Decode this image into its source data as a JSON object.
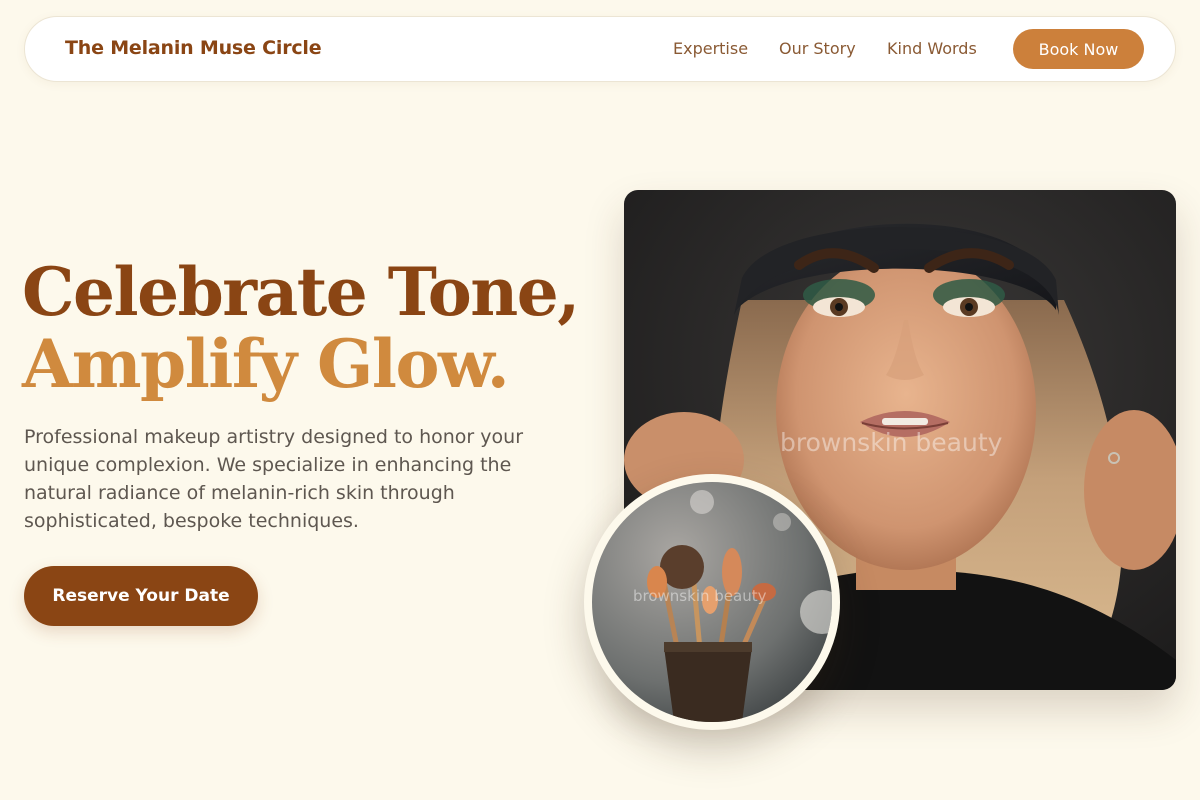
{
  "nav": {
    "brand": "The Melanin Muse Circle",
    "links": [
      {
        "label": "Expertise"
      },
      {
        "label": "Our Story"
      },
      {
        "label": "Kind Words"
      }
    ],
    "cta_label": "Book Now"
  },
  "hero": {
    "headline_line1": "Celebrate Tone,",
    "headline_line2": "Amplify Glow.",
    "lead": "Professional makeup artistry designed to honor your unique complexion. We specialize in enhancing the natural radiance of melanin-rich skin through sophisticated, bespoke techniques.",
    "cta_label": "Reserve Your Date"
  },
  "media": {
    "watermark": "brownskin beauty"
  },
  "colors": {
    "background": "#fdf9ec",
    "brand_brown": "#8a4514",
    "accent_amber": "#cc803b",
    "text_gray": "#5e5750"
  }
}
